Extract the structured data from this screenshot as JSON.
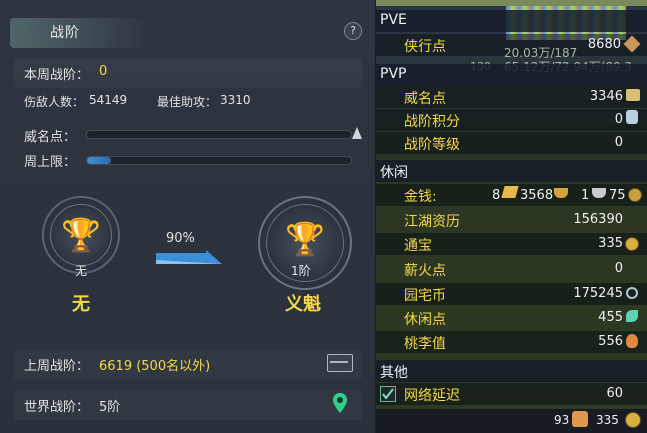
{
  "left": {
    "title": "战阶",
    "help": "?",
    "week_rank_label": "本周战阶：",
    "week_rank_value": "0",
    "injured_label": "伤敌人数：",
    "injured_value": "54149",
    "assist_label": "最佳助攻：",
    "assist_value": "3310",
    "prestige_label": "威名点：",
    "prestige_fill": 0.0,
    "weekly_cap_label": "周上限：",
    "weekly_cap_fill": 0.09,
    "percent": "90%",
    "current_small": "无",
    "current_name": "无",
    "next_small": "1阶",
    "next_name": "义魁",
    "last_week_label": "上周战阶：",
    "last_week_value": "6619 (500名以外)",
    "world_label": "世界战阶：",
    "world_value": "5阶"
  },
  "right": {
    "pve": "PVE",
    "pvp": "PVP",
    "leisure": "休闲",
    "other": "其他",
    "bg_text_1": "20.03万/187",
    "bg_text_2": "65.12万/72.94万(89.3",
    "bg_num": "130",
    "items_pve": [
      {
        "label": "侠行点",
        "value": "8680"
      }
    ],
    "items_pvp": [
      {
        "label": "威名点",
        "value": "3346"
      },
      {
        "label": "战阶积分",
        "value": "0"
      },
      {
        "label": "战阶等级",
        "value": "0"
      }
    ],
    "money": {
      "label": "金钱:",
      "gold": "8",
      "silver": "3568",
      "copper": "1",
      "ding": "75"
    },
    "items_leisure": [
      {
        "label": "江湖资历",
        "value": "156390"
      },
      {
        "label": "通宝",
        "value": "335"
      },
      {
        "label": "薪火点",
        "value": "0"
      },
      {
        "label": "园宅币",
        "value": "175245"
      },
      {
        "label": "休闲点",
        "value": "455"
      },
      {
        "label": "桃李值",
        "value": "556"
      }
    ],
    "network_label": "网络延迟",
    "network_value": "60",
    "footer_a": "93",
    "footer_b": "335"
  },
  "colors": {
    "accent_yellow": "#f4d84a",
    "bar_blue": "#3f8fd4"
  }
}
